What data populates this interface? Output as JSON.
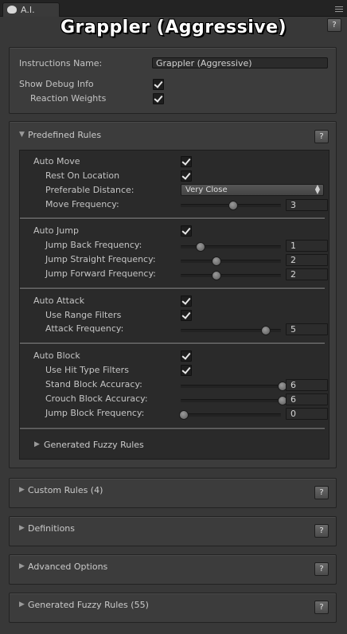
{
  "window": {
    "tab_label": "A.I.",
    "title": "Grappler (Aggressive)"
  },
  "help_label": "?",
  "general": {
    "instructions_name_label": "Instructions Name:",
    "instructions_name_value": "Grappler (Aggressive)",
    "show_debug_info_label": "Show Debug Info",
    "show_debug_info_checked": true,
    "reaction_weights_label": "Reaction Weights",
    "reaction_weights_checked": true
  },
  "predefined_rules": {
    "header": "Predefined Rules",
    "expanded": true,
    "auto_move": {
      "label": "Auto Move",
      "checked": true,
      "rest_on_location_label": "Rest On Location",
      "rest_on_location_checked": true,
      "preferable_distance_label": "Preferable Distance:",
      "preferable_distance_value": "Very Close",
      "move_frequency_label": "Move Frequency:",
      "move_frequency_value": "3",
      "move_frequency_fraction": 0.5
    },
    "auto_jump": {
      "label": "Auto Jump",
      "checked": true,
      "back_label": "Jump Back Frequency:",
      "back_value": "1",
      "back_fraction": 0.17,
      "straight_label": "Jump Straight Frequency:",
      "straight_value": "2",
      "straight_fraction": 0.33,
      "forward_label": "Jump Forward Frequency:",
      "forward_value": "2",
      "forward_fraction": 0.33
    },
    "auto_attack": {
      "label": "Auto Attack",
      "checked": true,
      "range_filters_label": "Use Range Filters",
      "range_filters_checked": true,
      "attack_frequency_label": "Attack Frequency:",
      "attack_frequency_value": "5",
      "attack_frequency_fraction": 0.83
    },
    "auto_block": {
      "label": "Auto Block",
      "checked": true,
      "hit_type_label": "Use Hit Type Filters",
      "hit_type_checked": true,
      "stand_label": "Stand Block Accuracy:",
      "stand_value": "6",
      "stand_fraction": 1.0,
      "crouch_label": "Crouch Block Accuracy:",
      "crouch_value": "6",
      "crouch_fraction": 1.0,
      "jump_label": "Jump Block Frequency:",
      "jump_value": "0",
      "jump_fraction": 0.0
    },
    "generated_fuzzy_rules": "Generated Fuzzy Rules"
  },
  "collapsed_sections": {
    "custom_rules": "Custom Rules (4)",
    "definitions": "Definitions",
    "advanced_options": "Advanced Options",
    "generated_fuzzy_rules": "Generated Fuzzy Rules (55)"
  },
  "colors": {
    "background": "#383838",
    "panel": "#3c3c3c",
    "inner_panel": "#2a2a2a",
    "text": "#c4c4c4"
  }
}
